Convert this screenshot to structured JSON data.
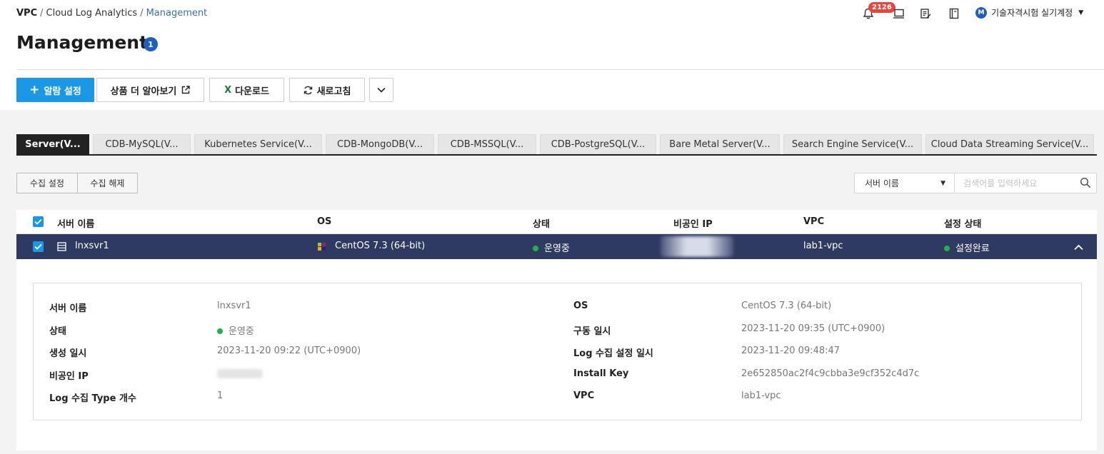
{
  "breadcrumb": {
    "root": "VPC",
    "middle": "Cloud Log Analytics",
    "current": "Management"
  },
  "header": {
    "notification_count": "2126",
    "account_initial": "M",
    "account_name": "기술자격시험 실기계정"
  },
  "page": {
    "title": "Management",
    "title_badge": "1"
  },
  "toolbar": {
    "alarm_label": "알람 설정",
    "learn_more_label": "상품 더 알아보기",
    "download_label": "다운로드",
    "refresh_label": "새로고침"
  },
  "tabs": [
    {
      "label": "Server(V..."
    },
    {
      "label": "CDB-MySQL(V..."
    },
    {
      "label": "Kubernetes Service(V..."
    },
    {
      "label": "CDB-MongoDB(V..."
    },
    {
      "label": "CDB-MSSQL(V..."
    },
    {
      "label": "CDB-PostgreSQL(V..."
    },
    {
      "label": "Bare Metal Server(V..."
    },
    {
      "label": "Search Engine Service(V..."
    },
    {
      "label": "Cloud Data Streaming Service(V..."
    }
  ],
  "collect": {
    "set_label": "수집 설정",
    "unset_label": "수집 해제"
  },
  "search": {
    "field_selected": "서버 이름",
    "placeholder": "검색어를 입력하세요"
  },
  "table": {
    "columns": {
      "name": "서버 이름",
      "os": "OS",
      "status": "상태",
      "private_ip": "비공인 IP",
      "vpc": "VPC",
      "setting_status": "설정 상태"
    },
    "row": {
      "name": "lnxsvr1",
      "os": "CentOS 7.3 (64-bit)",
      "status": "운영중",
      "vpc": "lab1-vpc",
      "setting_status": "설정완료"
    }
  },
  "detail": {
    "left": [
      {
        "label": "서버 이름",
        "value": "lnxsvr1"
      },
      {
        "label": "상태",
        "value": "운영중"
      },
      {
        "label": "생성 일시",
        "value": "2023-11-20 09:22 (UTC+0900)"
      },
      {
        "label": "비공인 IP",
        "value": ""
      },
      {
        "label": "Log 수집 Type 개수",
        "value": "1"
      }
    ],
    "right": [
      {
        "label": "OS",
        "value": "CentOS 7.3 (64-bit)"
      },
      {
        "label": "구동 일시",
        "value": "2023-11-20 09:35 (UTC+0900)"
      },
      {
        "label": "Log 수집 설정 일시",
        "value": "2023-11-20 09:48:47"
      },
      {
        "label": "Install Key",
        "value": "2e652850ac2f4c9cbba3e9cf352c4d7c"
      },
      {
        "label": "VPC",
        "value": "lab1-vpc"
      }
    ]
  },
  "colors": {
    "primary": "#1a98e6",
    "selected_row": "#2f3a63",
    "status_green": "#22b14c",
    "badge_red": "#e8453c"
  }
}
